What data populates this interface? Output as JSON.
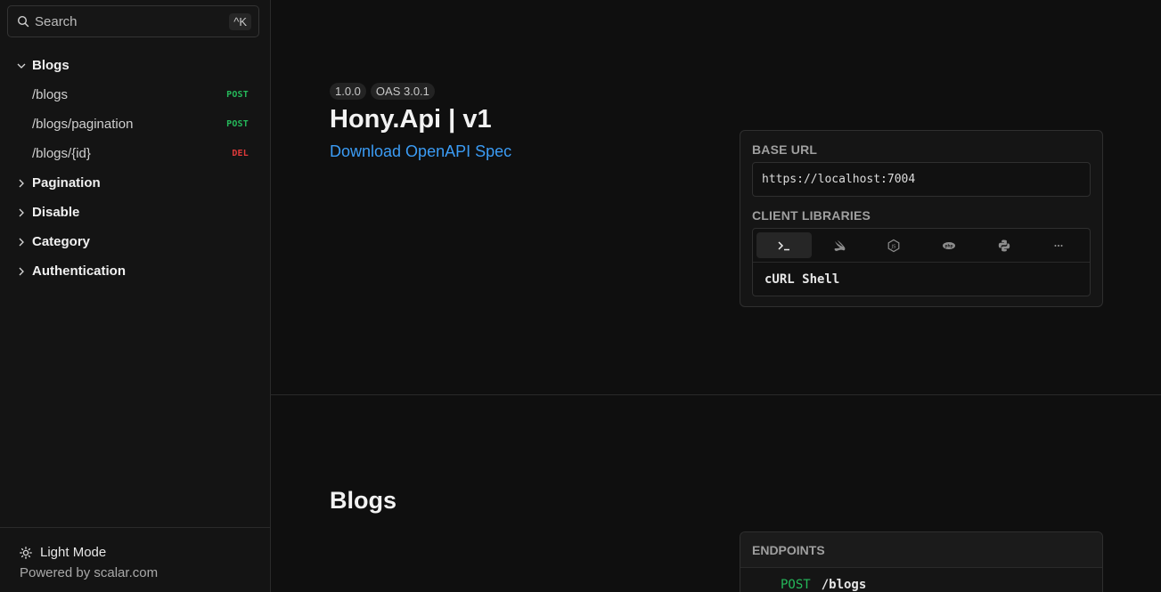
{
  "search": {
    "placeholder": "Search",
    "shortcut": "^K"
  },
  "sidebar": {
    "groups": [
      {
        "label": "Blogs",
        "expanded": true,
        "items": [
          {
            "label": "/blogs",
            "method": "POST"
          },
          {
            "label": "/blogs/pagination",
            "method": "POST"
          },
          {
            "label": "/blogs/{id}",
            "method": "DEL"
          }
        ]
      },
      {
        "label": "Pagination",
        "expanded": false
      },
      {
        "label": "Disable",
        "expanded": false
      },
      {
        "label": "Category",
        "expanded": false
      },
      {
        "label": "Authentication",
        "expanded": false
      }
    ],
    "footer": {
      "mode_label": "Light Mode",
      "powered_by": "Powered by scalar.com"
    }
  },
  "main": {
    "badges": [
      "1.0.0",
      "OAS 3.0.1"
    ],
    "title": "Hony.Api | v1",
    "download_link": "Download OpenAPI Spec",
    "info_card": {
      "base_url_label": "BASE URL",
      "base_url": "https://localhost:7004",
      "client_libraries_label": "CLIENT LIBRARIES",
      "libraries": [
        {
          "icon": "terminal-icon",
          "active": true
        },
        {
          "icon": "swift-icon",
          "active": false
        },
        {
          "icon": "nodejs-icon",
          "active": false
        },
        {
          "icon": "php-icon",
          "active": false
        },
        {
          "icon": "python-icon",
          "active": false
        },
        {
          "icon": "more-icon",
          "active": false
        }
      ],
      "selected_library": "cURL Shell"
    },
    "section": {
      "title": "Blogs",
      "endpoints_label": "ENDPOINTS",
      "endpoints": [
        {
          "method": "POST",
          "path": "/blogs"
        }
      ]
    }
  },
  "colors": {
    "background": "#0f0f0f",
    "sidebar": "#141414",
    "link": "#3b9cf5",
    "post": "#25b85a",
    "delete": "#e03a3a"
  }
}
